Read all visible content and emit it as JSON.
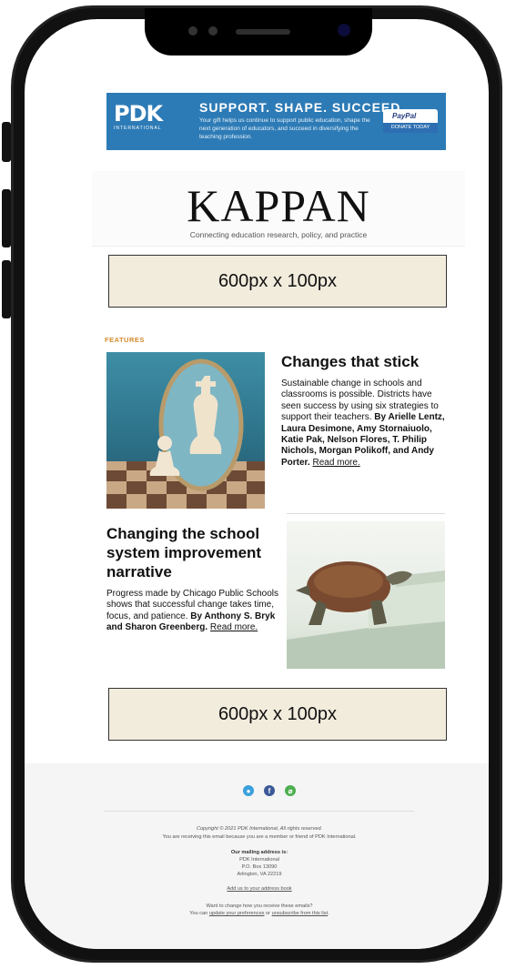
{
  "banner": {
    "logo_text": "PDK",
    "logo_sub": "INTERNATIONAL",
    "headline": "SUPPORT. SHAPE. SUCCEED.",
    "subtext": "Your gift helps us continue to support public education, shape the next generation of educators, and succeed in diversifying the teaching profession.",
    "paypal": "PayPal",
    "donate": "DONATE TODAY",
    "color": "#2d7bb6"
  },
  "masthead": {
    "title": "KAPPAN",
    "tagline": "Connecting education research, policy, and practice"
  },
  "ads": {
    "top_label": "600px x 100px",
    "bottom_label": "600px x 100px"
  },
  "features": {
    "label": "FEATURES",
    "articles": [
      {
        "title": "Changes that stick",
        "body": "Sustainable change in schools and classrooms is possible. Districts have seen success by using six strategies to support their teachers.",
        "byline": "By Arielle Lentz, Laura Desimone, Amy Stornaiuolo, Katie Pak, Nelson Flores, T. Philip Nichols, Morgan Polikoff, and Andy Porter.",
        "more": "Read more."
      },
      {
        "title": "Changing the school system improvement narrative",
        "body": "Progress made by Chicago Public Schools shows that successful change takes time, focus, and patience.",
        "byline": "By Anthony S. Bryk and Sharon Greenberg.",
        "more": "Read more."
      }
    ]
  },
  "footer": {
    "social_icons": [
      "twitter-icon",
      "facebook-icon",
      "website-icon"
    ],
    "copyright": "Copyright © 2021 PDK International, All rights reserved.",
    "reason": "You are receiving this email because you are a member or friend of PDK International.",
    "mailing_label": "Our mailing address is:",
    "address": [
      "PDK International",
      "P.O. Box 13090",
      "Arlington, VA 22219"
    ],
    "add_link": "Add us to your address book",
    "change_text": "Want to change how you receive these emails?",
    "you_can": "You can",
    "update_link": "update your preferences",
    "or_text": "or",
    "unsubscribe_link": "unsubscribe from this list"
  }
}
